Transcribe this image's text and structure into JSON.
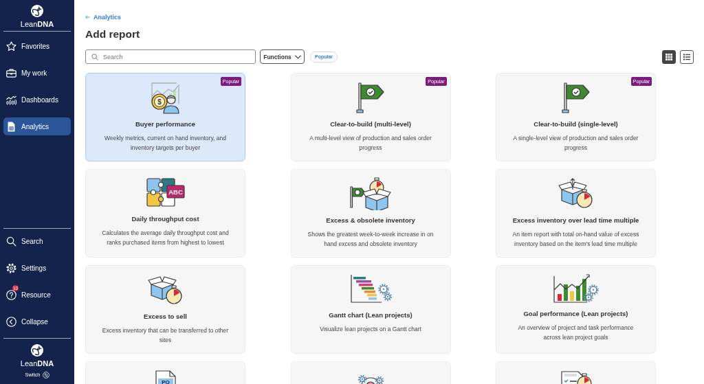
{
  "sidebar": {
    "logo": "Lean**DNA**",
    "nav_items": [
      {
        "label": "Favorites",
        "selected": false
      },
      {
        "label": "My work",
        "selected": false
      },
      {
        "label": "Dashboards",
        "selected": false
      },
      {
        "label": "Analytics",
        "selected": true
      }
    ],
    "bottom_items": [
      {
        "label": "Search"
      },
      {
        "label": "Settings"
      },
      {
        "label": "Resource",
        "badge": "10"
      },
      {
        "label": "Collapse"
      }
    ],
    "footer": {
      "logo": "Lean**DNA**",
      "switch_label": "Switch"
    }
  },
  "breadcrumb": {
    "label": "Analytics"
  },
  "page_title": "Add report",
  "toolbar": {
    "search": {
      "placeholder": "Search"
    },
    "functions": {
      "label": "Functions"
    },
    "popular_filter": {
      "label": "Popular",
      "selected": false
    },
    "view_modes": [
      {
        "kind": "grid",
        "selected": true
      },
      {
        "kind": "list",
        "selected": false
      }
    ]
  },
  "reports": [
    {
      "title": "Buyer performance",
      "description": "Weekly metrics, current on hand inventory, and inventory targets per buyer",
      "badge": "Popular",
      "icon_label": "$",
      "selected": true
    },
    {
      "title": "Clear-to-build (multi-level)",
      "description": "A multi-level view of production and sales order progress",
      "badge": "Popular",
      "selected": false
    },
    {
      "title": "Clear-to-build (single-level)",
      "description": "A single-level view of production and sales order progress",
      "badge": "Popular",
      "selected": false
    },
    {
      "title": "Daily throughput cost",
      "description": "Calculates the average daily throughput cost and ranks purchased items from highest to lowest",
      "icon_label": "ABC",
      "selected": false
    },
    {
      "title": "Excess & obsolete inventory",
      "description": "Shows the greatest week-to-week increase in on hand excess and obsolete inventory",
      "selected": false
    },
    {
      "title": "Excess inventory over lead time multiple",
      "description": "An item report with total on-hand value of excess inventory based on the item's lead time multiple",
      "selected": false
    },
    {
      "title": "Excess to sell",
      "description": "Excess inventory that can be transferred to other sites",
      "selected": false
    },
    {
      "title": "Gantt chart (Lean projects)",
      "description": "Visualize lean projects on a Gantt chart",
      "selected": false
    },
    {
      "title": "Goal performance (Lean projects)",
      "description": "An overview of project and task performance across lean project goals",
      "selected": false
    },
    {
      "icon_label": "PO",
      "selected": false
    },
    {
      "selected": false
    },
    {
      "selected": false
    }
  ]
}
